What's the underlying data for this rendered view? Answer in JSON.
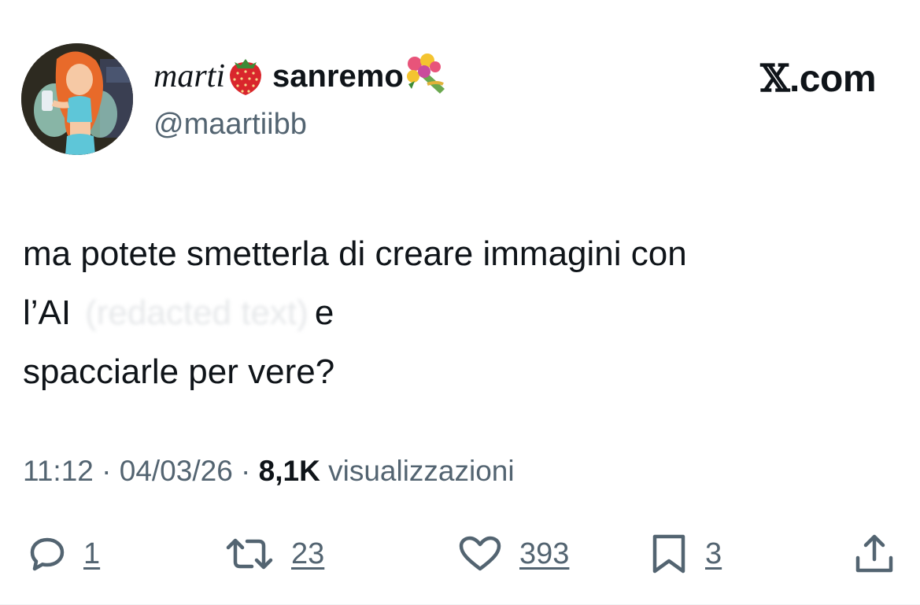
{
  "author": {
    "name_part1": "marti",
    "name_emoji1": "strawberry-emoji",
    "name_part2": "sanremo",
    "name_emoji2": "bouquet-emoji",
    "handle": "@maartiibb",
    "avatar": "avatar-image"
  },
  "brand": {
    "mark": "𝕏",
    "suffix": ".com"
  },
  "tweet": {
    "line1": "ma potete smetterla di creare immagini con",
    "line2_start": "l’AI",
    "line2_hidden": "(redacted text)",
    "line2_end": "e",
    "line3": "spacciarle per vere?"
  },
  "meta": {
    "time": "11:12",
    "separator1": " · ",
    "date": "04/03/26",
    "separator2": " · ",
    "views_count": "8,1K",
    "views_label": " visualizzazioni"
  },
  "actions": {
    "reply_count": "1",
    "repost_count": "23",
    "like_count": "393",
    "bookmark_count": "3",
    "icons": [
      "reply-icon",
      "repost-icon",
      "like-icon",
      "bookmark-icon",
      "share-icon"
    ]
  },
  "colors": {
    "text_primary": "#0f1419",
    "text_secondary": "#536471",
    "background": "#ffffff"
  }
}
